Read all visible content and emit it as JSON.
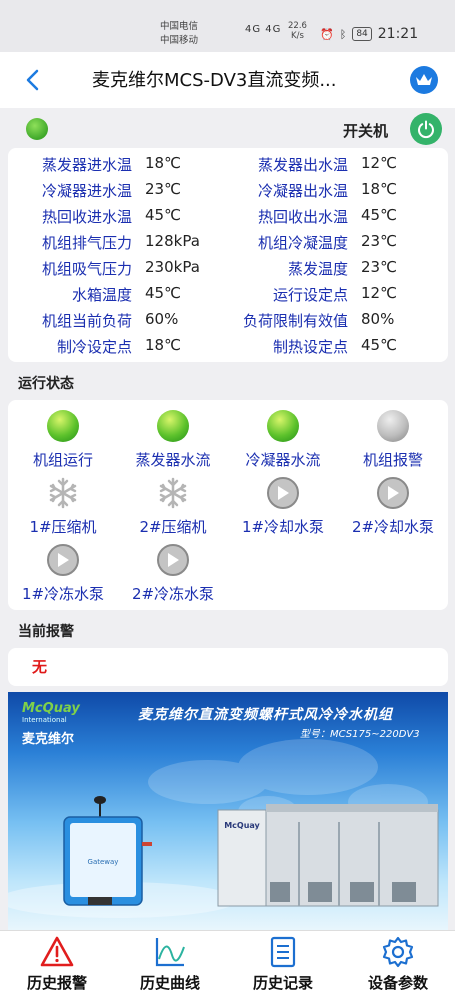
{
  "status_bar": {
    "carrier1": "中国电信",
    "carrier2": "中国移动",
    "network": "4G  4G",
    "speed_value": "22.6",
    "speed_unit": "K/s",
    "battery": "84",
    "time": "21:21"
  },
  "header": {
    "title": "麦克维尔MCS-DV3直流变频..."
  },
  "power": {
    "label": "开关机"
  },
  "params": [
    {
      "l1": "蒸发器进水温",
      "v1": "18℃",
      "l2": "蒸发器出水温",
      "v2": "12℃"
    },
    {
      "l1": "冷凝器进水温",
      "v1": "23℃",
      "l2": "冷凝器出水温",
      "v2": "18℃"
    },
    {
      "l1": "热回收进水温",
      "v1": "45℃",
      "l2": "热回收出水温",
      "v2": "45℃"
    },
    {
      "l1": "机组排气压力",
      "v1": "128kPa",
      "l2": "机组冷凝温度",
      "v2": "23℃"
    },
    {
      "l1": "机组吸气压力",
      "v1": "230kPa",
      "l2": "蒸发温度",
      "v2": "23℃"
    },
    {
      "l1": "水箱温度",
      "v1": "45℃",
      "l2": "运行设定点",
      "v2": "12℃"
    },
    {
      "l1": "机组当前负荷",
      "v1": "60%",
      "l2": "负荷限制有效值",
      "v2": "80%"
    },
    {
      "l1": "制冷设定点",
      "v1": "18℃",
      "l2": "制热设定点",
      "v2": "45℃"
    }
  ],
  "running_status": {
    "title": "运行状态",
    "items": [
      {
        "label": "机组运行",
        "icon": "green-indicator-icon"
      },
      {
        "label": "蒸发器水流",
        "icon": "green-indicator-icon"
      },
      {
        "label": "冷凝器水流",
        "icon": "green-indicator-icon"
      },
      {
        "label": "机组报警",
        "icon": "gray-indicator-icon"
      },
      {
        "label": "1#压缩机",
        "icon": "snowflake-icon"
      },
      {
        "label": "2#压缩机",
        "icon": "snowflake-icon"
      },
      {
        "label": "1#冷却水泵",
        "icon": "play-icon"
      },
      {
        "label": "2#冷却水泵",
        "icon": "play-icon"
      },
      {
        "label": "1#冷冻水泵",
        "icon": "play-icon"
      },
      {
        "label": "2#冷冻水泵",
        "icon": "play-icon"
      }
    ]
  },
  "current_alarm": {
    "title": "当前报警",
    "value": "无"
  },
  "banner": {
    "logo_en": "McQuay",
    "logo_sub": "International",
    "logo_cn": "麦克维尔",
    "title": "麦克维尔直流变频螺杆式风冷冷水机组",
    "model": "型号：MCS175~220DV3",
    "gateway_text": "Gateway"
  },
  "nav": {
    "items": [
      {
        "label": "历史报警",
        "icon": "warning-icon"
      },
      {
        "label": "历史曲线",
        "icon": "chart-icon"
      },
      {
        "label": "历史记录",
        "icon": "document-icon"
      },
      {
        "label": "设备参数",
        "icon": "gear-icon"
      }
    ]
  },
  "colors": {
    "label_blue": "#1b2fb0",
    "alarm_red": "#e01818",
    "power_green": "#34b36a",
    "crown_blue": "#1c7ae0"
  }
}
